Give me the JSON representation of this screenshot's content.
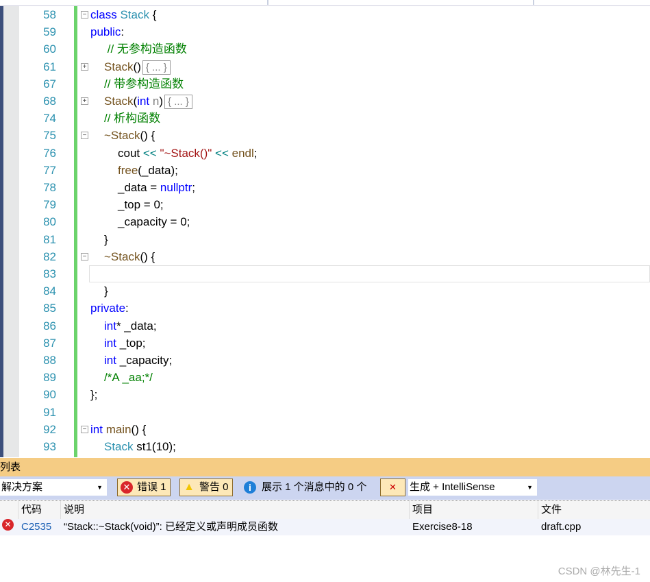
{
  "code": {
    "lines": [
      {
        "n": "58",
        "fold": "minus",
        "indent": 0,
        "tokens": [
          [
            "class ",
            "kw"
          ],
          [
            "Stack",
            "ty"
          ],
          [
            " {",
            ""
          ]
        ]
      },
      {
        "n": "59",
        "indent": 0,
        "tokens": [
          [
            "public",
            "kw"
          ],
          [
            ":",
            ""
          ]
        ]
      },
      {
        "n": "60",
        "indent": 1,
        "tokens": [
          [
            " // 无参构造函数",
            "cm"
          ]
        ]
      },
      {
        "n": "61",
        "fold": "plus",
        "indent": 1,
        "tokens": [
          [
            "Stack",
            "fn"
          ],
          [
            "()",
            ""
          ]
        ],
        "collapsed": "{ ... }"
      },
      {
        "n": "67",
        "indent": 1,
        "tokens": [
          [
            "// 带参构造函数",
            "cm"
          ]
        ]
      },
      {
        "n": "68",
        "fold": "plus",
        "indent": 1,
        "tokens": [
          [
            "Stack",
            "fn"
          ],
          [
            "(",
            ""
          ],
          [
            "int ",
            "kw"
          ],
          [
            "n",
            "pa"
          ],
          [
            ")",
            ""
          ]
        ],
        "collapsed": "{ ... }"
      },
      {
        "n": "74",
        "indent": 1,
        "tokens": [
          [
            "// 析构函数",
            "cm"
          ]
        ]
      },
      {
        "n": "75",
        "fold": "minus",
        "indent": 1,
        "tokens": [
          [
            "~Stack",
            "fn"
          ],
          [
            "() {",
            ""
          ]
        ]
      },
      {
        "n": "76",
        "indent": 2,
        "tokens": [
          [
            "cout ",
            ""
          ],
          [
            "<< ",
            "op"
          ],
          [
            "\"~Stack()\"",
            "st"
          ],
          [
            " ",
            ""
          ],
          [
            "<< ",
            "op"
          ],
          [
            "endl",
            "fn"
          ],
          [
            ";",
            ""
          ]
        ]
      },
      {
        "n": "77",
        "indent": 2,
        "tokens": [
          [
            "free",
            "fn"
          ],
          [
            "(_data);",
            ""
          ]
        ]
      },
      {
        "n": "78",
        "indent": 2,
        "tokens": [
          [
            "_data = ",
            ""
          ],
          [
            "nullptr",
            "kw"
          ],
          [
            ";",
            ""
          ]
        ]
      },
      {
        "n": "79",
        "indent": 2,
        "tokens": [
          [
            "_top = 0;",
            ""
          ]
        ]
      },
      {
        "n": "80",
        "indent": 2,
        "tokens": [
          [
            "_capacity = 0;",
            ""
          ]
        ]
      },
      {
        "n": "81",
        "indent": 1,
        "tokens": [
          [
            "}",
            ""
          ]
        ]
      },
      {
        "n": "82",
        "fold": "minus",
        "indent": 1,
        "tokens": [
          [
            "~Stack",
            "fn"
          ],
          [
            "() {",
            ""
          ]
        ]
      },
      {
        "n": "83",
        "indent": 2,
        "current": true,
        "tokens": []
      },
      {
        "n": "84",
        "indent": 1,
        "tokens": [
          [
            "}",
            ""
          ]
        ]
      },
      {
        "n": "85",
        "indent": 0,
        "tokens": [
          [
            "private",
            "kw"
          ],
          [
            ":",
            ""
          ]
        ]
      },
      {
        "n": "86",
        "indent": 1,
        "tokens": [
          [
            "int",
            "kw"
          ],
          [
            "* _data;",
            ""
          ]
        ]
      },
      {
        "n": "87",
        "indent": 1,
        "tokens": [
          [
            "int ",
            "kw"
          ],
          [
            "_top;",
            ""
          ]
        ]
      },
      {
        "n": "88",
        "indent": 1,
        "tokens": [
          [
            "int ",
            "kw"
          ],
          [
            "_capacity;",
            ""
          ]
        ]
      },
      {
        "n": "89",
        "indent": 1,
        "tokens": [
          [
            "/*A _aa;*/",
            "cm"
          ]
        ]
      },
      {
        "n": "90",
        "indent": 0,
        "tokens": [
          [
            "};",
            ""
          ]
        ]
      },
      {
        "n": "91",
        "indent": 0,
        "tokens": []
      },
      {
        "n": "92",
        "fold": "minus",
        "indent": 0,
        "tokens": [
          [
            "int ",
            "kw"
          ],
          [
            "main",
            "fn"
          ],
          [
            "() {",
            ""
          ]
        ]
      },
      {
        "n": "93",
        "indent": 1,
        "tokens": [
          [
            "Stack ",
            "ty"
          ],
          [
            "st1(10);",
            ""
          ]
        ]
      }
    ]
  },
  "error_list": {
    "title": "列表",
    "scope": "解决方案",
    "errors_label": "错误 1",
    "warnings_label": "警告 0",
    "messages_label": "展示 1 个消息中的 0 个",
    "source": "生成 + IntelliSense",
    "columns": [
      "代码",
      "说明",
      "项目",
      "文件"
    ],
    "rows": [
      {
        "code": "C2535",
        "description": "“Stack::~Stack(void)”: 已经定义或声明成员函数",
        "project": "Exercise8-18",
        "file": "draft.cpp"
      }
    ]
  },
  "watermark": "CSDN @林先生-1"
}
